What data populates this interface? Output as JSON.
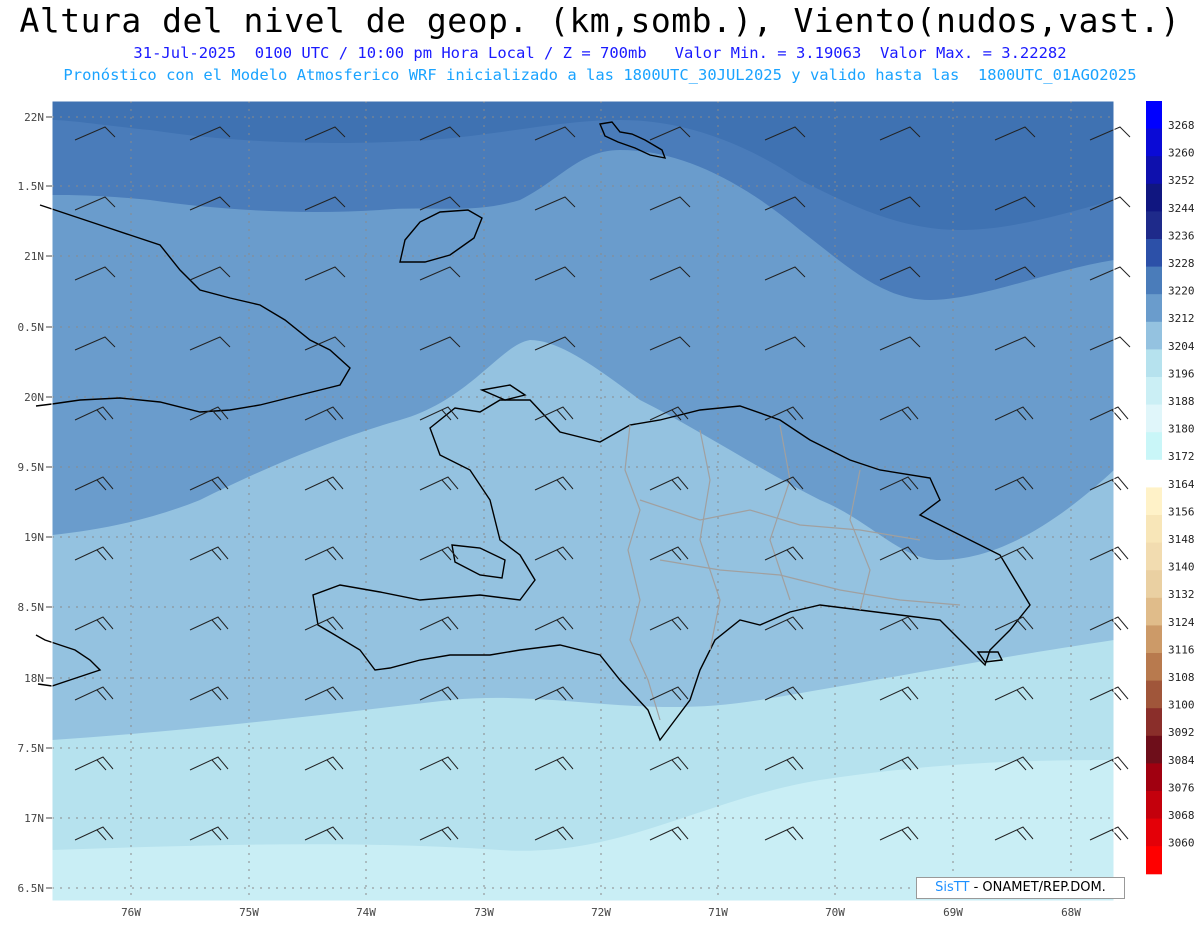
{
  "header": {
    "title": "Altura del nivel de geop. (km,somb.), Viento(nudos,vast.)",
    "subtitle": "31-Jul-2025  0100 UTC / 10:00 pm Hora Local / Z = 700mb   Valor Min. = 3.19063  Valor Max. = 3.22282",
    "model_line": "Pronóstico con el Modelo Atmosferico WRF inicializado a las 1800UTC_30JUL2025 y valido hasta las  1800UTC_01AGO2025"
  },
  "axes": {
    "lat_labels": [
      "22N",
      "1.5N",
      "21N",
      "0.5N",
      "20N",
      "9.5N",
      "19N",
      "8.5N",
      "18N",
      "7.5N",
      "17N",
      "6.5N"
    ],
    "lon_labels": [
      "76W",
      "75W",
      "74W",
      "73W",
      "72W",
      "71W",
      "70W",
      "69W",
      "68W"
    ]
  },
  "colorbar": {
    "labels": [
      "3268",
      "3260",
      "3252",
      "3244",
      "3236",
      "3228",
      "3220",
      "3212",
      "3204",
      "3196",
      "3188",
      "3180",
      "3172",
      "3164",
      "3156",
      "3148",
      "3140",
      "3132",
      "3124",
      "3116",
      "3108",
      "3100",
      "3092",
      "3084",
      "3076",
      "3068",
      "3060"
    ],
    "colors": [
      "#0000ff",
      "#0a0ad6",
      "#0e10ad",
      "#101680",
      "#1e2a8a",
      "#2c50a8",
      "#4a7cba",
      "#6a9ccc",
      "#94c2e0",
      "#b6e2ee",
      "#cbeff5",
      "#e0f6fa",
      "#c9f6f8",
      "#ffffff",
      "#fff2c8",
      "#f8e6b8",
      "#f2dcb0",
      "#ead0a2",
      "#e0bc8a",
      "#cc9a68",
      "#b87a4e",
      "#a0563a",
      "#8a2e2a",
      "#6e0e1a",
      "#a00010",
      "#c4000c",
      "#e40008",
      "#ff0000"
    ]
  },
  "credit": {
    "brand": "SisTT",
    "text": "- ONAMET/REP.DOM."
  },
  "map_colors": {
    "c3228": "#4a7cba",
    "c3220": "#6a9ccc",
    "c3212": "#94c2e0",
    "c3204": "#b6e2ee",
    "c3196": "#c9eef5",
    "coast": "#000000",
    "border": "#a0a0a0"
  }
}
